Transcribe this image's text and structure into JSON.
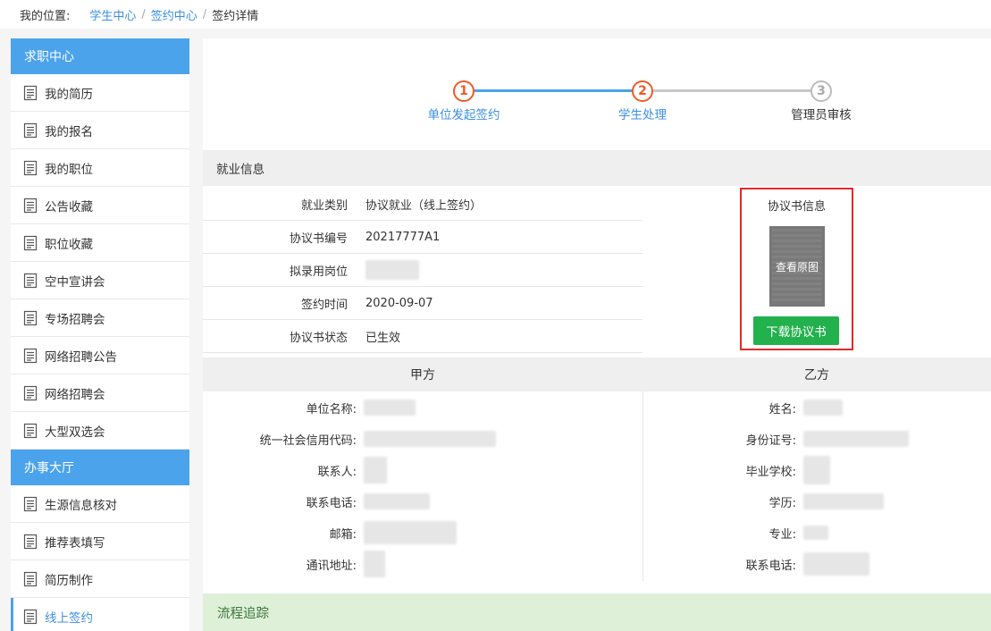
{
  "breadcrumb": {
    "label": "我的位置:",
    "items": [
      "学生中心",
      "签约中心"
    ],
    "current": "签约详情"
  },
  "sidebar": {
    "section1": "求职中心",
    "items1": [
      "我的简历",
      "我的报名",
      "我的职位",
      "公告收藏",
      "职位收藏",
      "空中宣讲会",
      "专场招聘会",
      "网络招聘公告",
      "网络招聘会",
      "大型双选会"
    ],
    "section2": "办事大厅",
    "items2": [
      "生源信息核对",
      "推荐表填写",
      "简历制作",
      "线上签约"
    ],
    "active": "线上签约"
  },
  "steps": [
    {
      "num": "1",
      "label": "单位发起签约",
      "state": "done"
    },
    {
      "num": "2",
      "label": "学生处理",
      "state": "current"
    },
    {
      "num": "3",
      "label": "管理员审核",
      "state": "todo"
    }
  ],
  "employment": {
    "title": "就业信息",
    "rows": [
      {
        "key": "就业类别",
        "value": "协议就业（线上签约）"
      },
      {
        "key": "协议书编号",
        "value": "20217777A1"
      },
      {
        "key": "拟录用岗位",
        "value": ""
      },
      {
        "key": "签约时间",
        "value": "2020-09-07"
      },
      {
        "key": "协议书状态",
        "value": "已生效"
      }
    ]
  },
  "agreement": {
    "title": "协议书信息",
    "view_label": "查看原图",
    "download_label": "下载协议书"
  },
  "party_a": {
    "title": "甲方",
    "fields": [
      "单位名称:",
      "统一社会信用代码:",
      "联系人:",
      "联系电话:",
      "邮箱:",
      "通讯地址:"
    ]
  },
  "party_b": {
    "title": "乙方",
    "fields": [
      "姓名:",
      "身份证号:",
      "毕业学校:",
      "学历:",
      "专业:",
      "联系电话:"
    ]
  },
  "flow_title": "流程追踪",
  "colors": {
    "accent": "#4ba3ec",
    "link": "#3a8ee6",
    "step_active": "#f05a28",
    "download": "#22b14c",
    "highlight": "#e0292b"
  }
}
